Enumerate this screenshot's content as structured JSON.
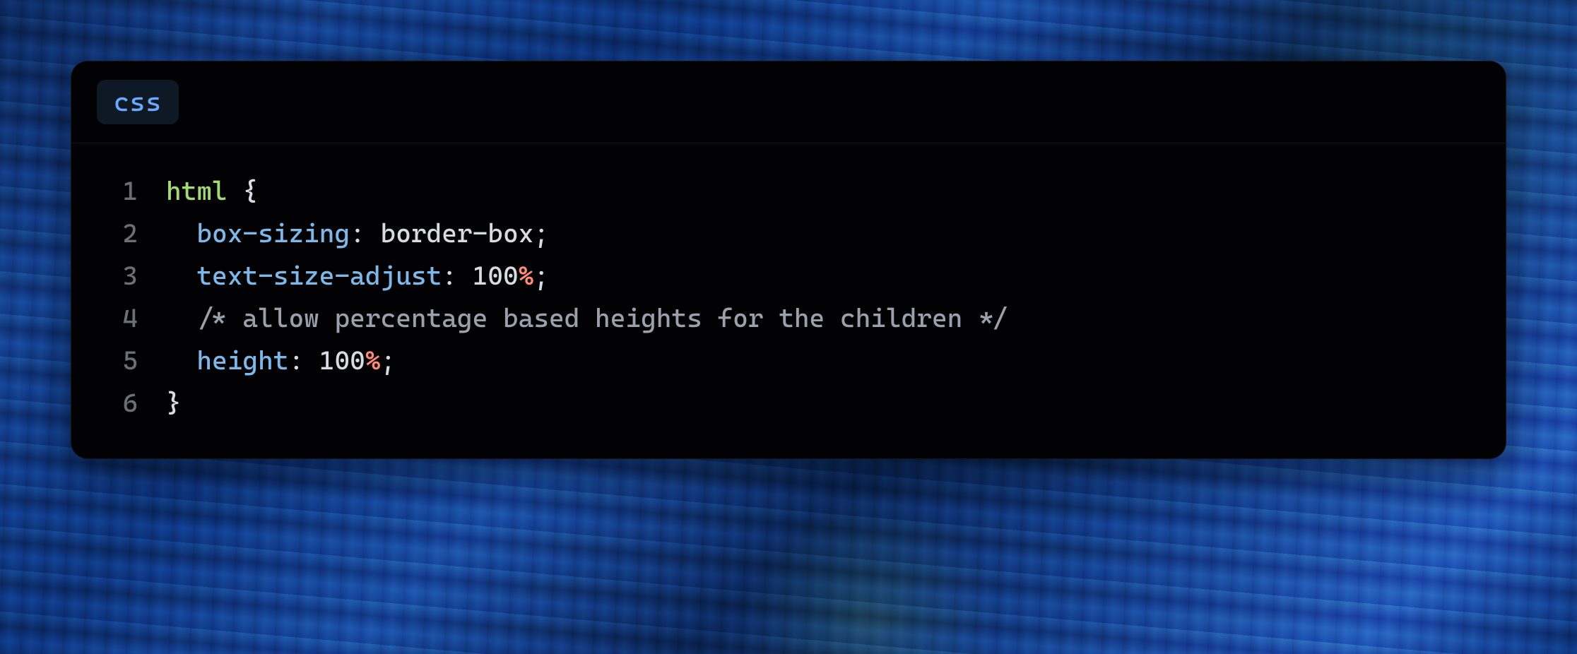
{
  "header": {
    "language_label": "css"
  },
  "code": {
    "lines": [
      {
        "n": "1",
        "indent": "",
        "tokens": [
          {
            "cls": "tok-selector",
            "t": "html"
          },
          {
            "cls": "tok-punct",
            "t": " {"
          }
        ]
      },
      {
        "n": "2",
        "indent": "  ",
        "tokens": [
          {
            "cls": "tok-prop",
            "t": "box-sizing"
          },
          {
            "cls": "tok-punct",
            "t": ": "
          },
          {
            "cls": "tok-value",
            "t": "border-box"
          },
          {
            "cls": "tok-punct",
            "t": ";"
          }
        ]
      },
      {
        "n": "3",
        "indent": "  ",
        "tokens": [
          {
            "cls": "tok-prop",
            "t": "text-size-adjust"
          },
          {
            "cls": "tok-punct",
            "t": ": "
          },
          {
            "cls": "tok-number",
            "t": "100"
          },
          {
            "cls": "tok-unit",
            "t": "%"
          },
          {
            "cls": "tok-punct",
            "t": ";"
          }
        ]
      },
      {
        "n": "4",
        "indent": "  ",
        "tokens": [
          {
            "cls": "tok-comment",
            "t": "/* allow percentage based heights for the children */"
          }
        ]
      },
      {
        "n": "5",
        "indent": "  ",
        "tokens": [
          {
            "cls": "tok-prop",
            "t": "height"
          },
          {
            "cls": "tok-punct",
            "t": ": "
          },
          {
            "cls": "tok-number",
            "t": "100"
          },
          {
            "cls": "tok-unit",
            "t": "%"
          },
          {
            "cls": "tok-punct",
            "t": ";"
          }
        ]
      },
      {
        "n": "6",
        "indent": "",
        "tokens": [
          {
            "cls": "tok-punct",
            "t": "}"
          }
        ]
      }
    ]
  }
}
